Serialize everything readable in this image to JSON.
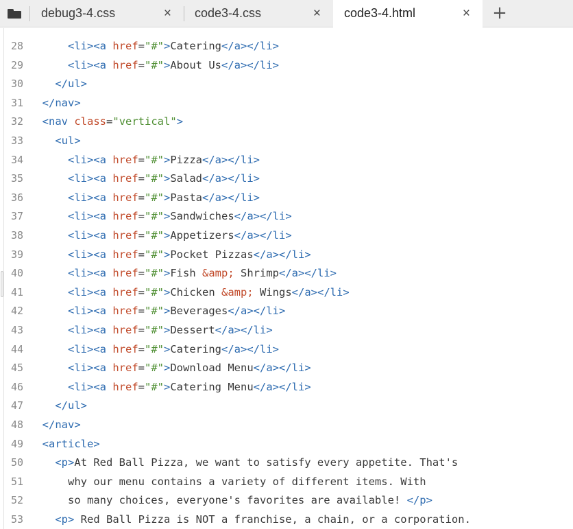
{
  "tabs": [
    {
      "label": "debug3-4.css",
      "active": false
    },
    {
      "label": "code3-4.css",
      "active": false
    },
    {
      "label": "code3-4.html",
      "active": true
    }
  ],
  "tab_close_glyph": "×",
  "new_tab_glyph": "+",
  "icons": {
    "folder": "folder-icon",
    "close": "close-icon",
    "plus": "plus-icon"
  },
  "colors": {
    "tag": "#2d6bb0",
    "attr": "#c14a2a",
    "string": "#4f8f33",
    "text": "#3a3a3a",
    "line_number": "#8a8a8a"
  },
  "lines": [
    {
      "n": "28",
      "tokens": [
        [
          "txt",
          "      "
        ],
        [
          "tag",
          "<li><a "
        ],
        [
          "attr",
          "href"
        ],
        [
          "txt",
          "="
        ],
        [
          "str",
          "\"#\""
        ],
        [
          "tag",
          ">"
        ],
        [
          "txt",
          "Catering"
        ],
        [
          "tag",
          "</a></li>"
        ]
      ]
    },
    {
      "n": "29",
      "tokens": [
        [
          "txt",
          "      "
        ],
        [
          "tag",
          "<li><a "
        ],
        [
          "attr",
          "href"
        ],
        [
          "txt",
          "="
        ],
        [
          "str",
          "\"#\""
        ],
        [
          "tag",
          ">"
        ],
        [
          "txt",
          "About Us"
        ],
        [
          "tag",
          "</a></li>"
        ]
      ]
    },
    {
      "n": "30",
      "tokens": [
        [
          "txt",
          "    "
        ],
        [
          "tag",
          "</ul>"
        ]
      ]
    },
    {
      "n": "31",
      "tokens": [
        [
          "txt",
          "  "
        ],
        [
          "tag",
          "</nav>"
        ]
      ]
    },
    {
      "n": "32",
      "tokens": [
        [
          "txt",
          "  "
        ],
        [
          "tag",
          "<nav "
        ],
        [
          "attr",
          "class"
        ],
        [
          "txt",
          "="
        ],
        [
          "str",
          "\"vertical\""
        ],
        [
          "tag",
          ">"
        ]
      ]
    },
    {
      "n": "33",
      "tokens": [
        [
          "txt",
          "    "
        ],
        [
          "tag",
          "<ul>"
        ]
      ]
    },
    {
      "n": "34",
      "tokens": [
        [
          "txt",
          "      "
        ],
        [
          "tag",
          "<li><a "
        ],
        [
          "attr",
          "href"
        ],
        [
          "txt",
          "="
        ],
        [
          "str",
          "\"#\""
        ],
        [
          "tag",
          ">"
        ],
        [
          "txt",
          "Pizza"
        ],
        [
          "tag",
          "</a></li>"
        ]
      ]
    },
    {
      "n": "35",
      "tokens": [
        [
          "txt",
          "      "
        ],
        [
          "tag",
          "<li><a "
        ],
        [
          "attr",
          "href"
        ],
        [
          "txt",
          "="
        ],
        [
          "str",
          "\"#\""
        ],
        [
          "tag",
          ">"
        ],
        [
          "txt",
          "Salad"
        ],
        [
          "tag",
          "</a></li>"
        ]
      ]
    },
    {
      "n": "36",
      "tokens": [
        [
          "txt",
          "      "
        ],
        [
          "tag",
          "<li><a "
        ],
        [
          "attr",
          "href"
        ],
        [
          "txt",
          "="
        ],
        [
          "str",
          "\"#\""
        ],
        [
          "tag",
          ">"
        ],
        [
          "txt",
          "Pasta"
        ],
        [
          "tag",
          "</a></li>"
        ]
      ]
    },
    {
      "n": "37",
      "tokens": [
        [
          "txt",
          "      "
        ],
        [
          "tag",
          "<li><a "
        ],
        [
          "attr",
          "href"
        ],
        [
          "txt",
          "="
        ],
        [
          "str",
          "\"#\""
        ],
        [
          "tag",
          ">"
        ],
        [
          "txt",
          "Sandwiches"
        ],
        [
          "tag",
          "</a></li>"
        ]
      ]
    },
    {
      "n": "38",
      "tokens": [
        [
          "txt",
          "      "
        ],
        [
          "tag",
          "<li><a "
        ],
        [
          "attr",
          "href"
        ],
        [
          "txt",
          "="
        ],
        [
          "str",
          "\"#\""
        ],
        [
          "tag",
          ">"
        ],
        [
          "txt",
          "Appetizers"
        ],
        [
          "tag",
          "</a></li>"
        ]
      ]
    },
    {
      "n": "39",
      "tokens": [
        [
          "txt",
          "      "
        ],
        [
          "tag",
          "<li><a "
        ],
        [
          "attr",
          "href"
        ],
        [
          "txt",
          "="
        ],
        [
          "str",
          "\"#\""
        ],
        [
          "tag",
          ">"
        ],
        [
          "txt",
          "Pocket Pizzas"
        ],
        [
          "tag",
          "</a></li>"
        ]
      ]
    },
    {
      "n": "40",
      "tokens": [
        [
          "txt",
          "      "
        ],
        [
          "tag",
          "<li><a "
        ],
        [
          "attr",
          "href"
        ],
        [
          "txt",
          "="
        ],
        [
          "str",
          "\"#\""
        ],
        [
          "tag",
          ">"
        ],
        [
          "txt",
          "Fish "
        ],
        [
          "ent",
          "&amp;"
        ],
        [
          "txt",
          " Shrimp"
        ],
        [
          "tag",
          "</a></li>"
        ]
      ]
    },
    {
      "n": "41",
      "tokens": [
        [
          "txt",
          "      "
        ],
        [
          "tag",
          "<li><a "
        ],
        [
          "attr",
          "href"
        ],
        [
          "txt",
          "="
        ],
        [
          "str",
          "\"#\""
        ],
        [
          "tag",
          ">"
        ],
        [
          "txt",
          "Chicken "
        ],
        [
          "ent",
          "&amp;"
        ],
        [
          "txt",
          " Wings"
        ],
        [
          "tag",
          "</a></li>"
        ]
      ]
    },
    {
      "n": "42",
      "tokens": [
        [
          "txt",
          "      "
        ],
        [
          "tag",
          "<li><a "
        ],
        [
          "attr",
          "href"
        ],
        [
          "txt",
          "="
        ],
        [
          "str",
          "\"#\""
        ],
        [
          "tag",
          ">"
        ],
        [
          "txt",
          "Beverages"
        ],
        [
          "tag",
          "</a></li>"
        ]
      ]
    },
    {
      "n": "43",
      "tokens": [
        [
          "txt",
          "      "
        ],
        [
          "tag",
          "<li><a "
        ],
        [
          "attr",
          "href"
        ],
        [
          "txt",
          "="
        ],
        [
          "str",
          "\"#\""
        ],
        [
          "tag",
          ">"
        ],
        [
          "txt",
          "Dessert"
        ],
        [
          "tag",
          "</a></li>"
        ]
      ]
    },
    {
      "n": "44",
      "tokens": [
        [
          "txt",
          "      "
        ],
        [
          "tag",
          "<li><a "
        ],
        [
          "attr",
          "href"
        ],
        [
          "txt",
          "="
        ],
        [
          "str",
          "\"#\""
        ],
        [
          "tag",
          ">"
        ],
        [
          "txt",
          "Catering"
        ],
        [
          "tag",
          "</a></li>"
        ]
      ]
    },
    {
      "n": "45",
      "tokens": [
        [
          "txt",
          "      "
        ],
        [
          "tag",
          "<li><a "
        ],
        [
          "attr",
          "href"
        ],
        [
          "txt",
          "="
        ],
        [
          "str",
          "\"#\""
        ],
        [
          "tag",
          ">"
        ],
        [
          "txt",
          "Download Menu"
        ],
        [
          "tag",
          "</a></li>"
        ]
      ]
    },
    {
      "n": "46",
      "tokens": [
        [
          "txt",
          "      "
        ],
        [
          "tag",
          "<li><a "
        ],
        [
          "attr",
          "href"
        ],
        [
          "txt",
          "="
        ],
        [
          "str",
          "\"#\""
        ],
        [
          "tag",
          ">"
        ],
        [
          "txt",
          "Catering Menu"
        ],
        [
          "tag",
          "</a></li>"
        ]
      ]
    },
    {
      "n": "47",
      "tokens": [
        [
          "txt",
          "    "
        ],
        [
          "tag",
          "</ul>"
        ]
      ]
    },
    {
      "n": "48",
      "tokens": [
        [
          "txt",
          "  "
        ],
        [
          "tag",
          "</nav>"
        ]
      ]
    },
    {
      "n": "49",
      "tokens": [
        [
          "txt",
          "  "
        ],
        [
          "tag",
          "<article>"
        ]
      ]
    },
    {
      "n": "50",
      "tokens": [
        [
          "txt",
          "    "
        ],
        [
          "tag",
          "<p>"
        ],
        [
          "txt",
          "At Red Ball Pizza, we want to satisfy every appetite. That's"
        ]
      ]
    },
    {
      "n": "51",
      "tokens": [
        [
          "txt",
          "      why our menu contains a variety of different items. With"
        ]
      ]
    },
    {
      "n": "52",
      "tokens": [
        [
          "txt",
          "      so many choices, everyone's favorites are available! "
        ],
        [
          "tag",
          "</p>"
        ]
      ]
    },
    {
      "n": "53",
      "tokens": [
        [
          "txt",
          "    "
        ],
        [
          "tag",
          "<p>"
        ],
        [
          "txt",
          " Red Ball Pizza is NOT a franchise, a chain, or a corporation."
        ]
      ]
    }
  ]
}
